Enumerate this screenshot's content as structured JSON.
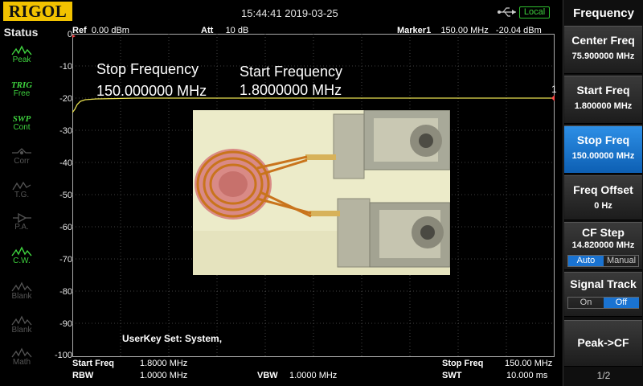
{
  "brand": "RIGOL",
  "clock": "15:44:41 2019-03-25",
  "remote_badge": "Local",
  "status": {
    "title": "Status",
    "buttons": [
      {
        "icon": "peak-icon",
        "label": "Peak",
        "active": true
      },
      {
        "icon": "trig-icon",
        "top": "TRIG",
        "label": "Free",
        "active": true
      },
      {
        "icon": "sweep-icon",
        "top": "SWP",
        "label": "Cont",
        "active": true
      },
      {
        "icon": "correction-icon",
        "label": "Corr",
        "active": false
      },
      {
        "icon": "tracking-generator-icon",
        "label": "T.G.",
        "active": false
      },
      {
        "icon": "preamp-icon",
        "label": "P.A.",
        "active": false
      },
      {
        "icon": "clear-write-icon",
        "label": "C.W.",
        "active": true
      },
      {
        "icon": "blank-icon",
        "label": "Blank",
        "active": false
      },
      {
        "icon": "blank-icon",
        "label": "Blank",
        "active": false
      },
      {
        "icon": "math-icon",
        "label": "Math",
        "active": false
      }
    ]
  },
  "header": {
    "ref_label": "Ref",
    "ref_value": "0.00 dBm",
    "att_label": "Att",
    "att_value": "10 dB",
    "marker_label": "Marker1",
    "marker_freq": "150.00 MHz",
    "marker_level": "-20.04 dBm"
  },
  "y_axis": {
    "ticks": [
      "0",
      "-10",
      "-20",
      "-30",
      "-40",
      "-50",
      "-60",
      "-70",
      "-80",
      "-90",
      "-100"
    ]
  },
  "overlay": {
    "stop_title": "Stop Frequency",
    "stop_value": "150.000000 MHz",
    "start_title": "Start Frequency",
    "start_value": "1.8000000 MHz",
    "marker_number": "1",
    "photo_description_icon": "toroid-transformer-photo"
  },
  "userkey": "UserKey Set:   System,",
  "footer": {
    "start_label": "Start Freq",
    "start_value": "1.8000 MHz",
    "stop_label": "Stop Freq",
    "stop_value": "150.00 MHz",
    "rbw_label": "RBW",
    "rbw_value": "1.0000 MHz",
    "vbw_label": "VBW",
    "vbw_value": "1.0000 MHz",
    "swt_label": "SWT",
    "swt_value": "10.000 ms"
  },
  "menu": {
    "title": "Frequency",
    "center_label": "Center Freq",
    "center_value": "75.900000 MHz",
    "start_label": "Start Freq",
    "start_value": "1.800000 MHz",
    "stop_label": "Stop Freq",
    "stop_value": "150.00000 MHz",
    "offset_label": "Freq Offset",
    "offset_value": "0 Hz",
    "cfstep_label": "CF Step",
    "cfstep_value": "14.820000 MHz",
    "cfstep_auto": "Auto",
    "cfstep_manual": "Manual",
    "signal_label": "Signal Track",
    "signal_on": "On",
    "signal_off": "Off",
    "peak_cf": "Peak->CF",
    "page": "1/2"
  },
  "colors": {
    "trace": "#e8e050",
    "accent": "#1a73d1",
    "status_on": "#3ed23e",
    "logo": "#f2c200"
  }
}
